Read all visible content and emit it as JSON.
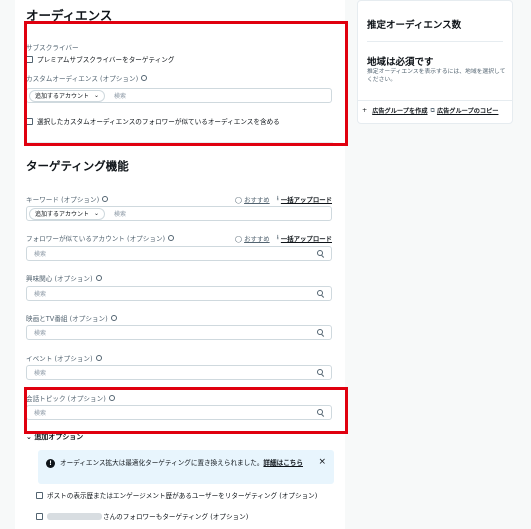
{
  "audience": {
    "title": "オーディエンス",
    "subscriber_label": "サブスクライバー",
    "premium_checkbox": "プレミアムサブスクライバーをターゲティング",
    "custom_label": "カスタムオーディエンス (オプション)",
    "custom_pill": "追加するアカウント",
    "custom_placeholder": "検索",
    "similar_checkbox": "選択したカスタムオーディエンスのフォロワーが似ているオーディエンスを含める"
  },
  "targeting": {
    "title": "ターゲティング機能",
    "keyword_label": "キーワード (オプション)",
    "keyword_pill": "追加するアカウント",
    "keyword_placeholder": "検索",
    "recommended": "おすすめ",
    "bulk_upload": "一括アップロード",
    "follower_label": "フォロワーが似ているアカウント (オプション)",
    "follower_placeholder": "検索",
    "interest_label": "興味関心 (オプション)",
    "interest_placeholder": "検索",
    "movie_label": "映画とTV番組 (オプション)",
    "movie_placeholder": "検索",
    "event_label": "イベント (オプション)",
    "event_placeholder": "検索",
    "topic_label": "会話トピック (オプション)",
    "topic_placeholder": "検索"
  },
  "advanced": {
    "title": "追加オプション",
    "notice_text": "オーディエンス拡大は最適化ターゲティングに置き換えられました。",
    "notice_link": "詳細はこちら",
    "retarget_checkbox": "ポストの表示歴またはエンゲージメント歴があるユーザーをリターゲティング (オプション)",
    "followers_checkbox": "さんのフォロワーもターゲティング (オプション)"
  },
  "sidebar": {
    "title": "推定オーディエンス数",
    "required": "地域は必須です",
    "description": "推定オーディエンスを表示するには、地域を選択してください。",
    "create_group": "広告グループを作成",
    "copy_group": "広告グループのコピー"
  },
  "colors": {
    "highlight": "#e0000f",
    "notice_bg": "#e8f5fd"
  }
}
